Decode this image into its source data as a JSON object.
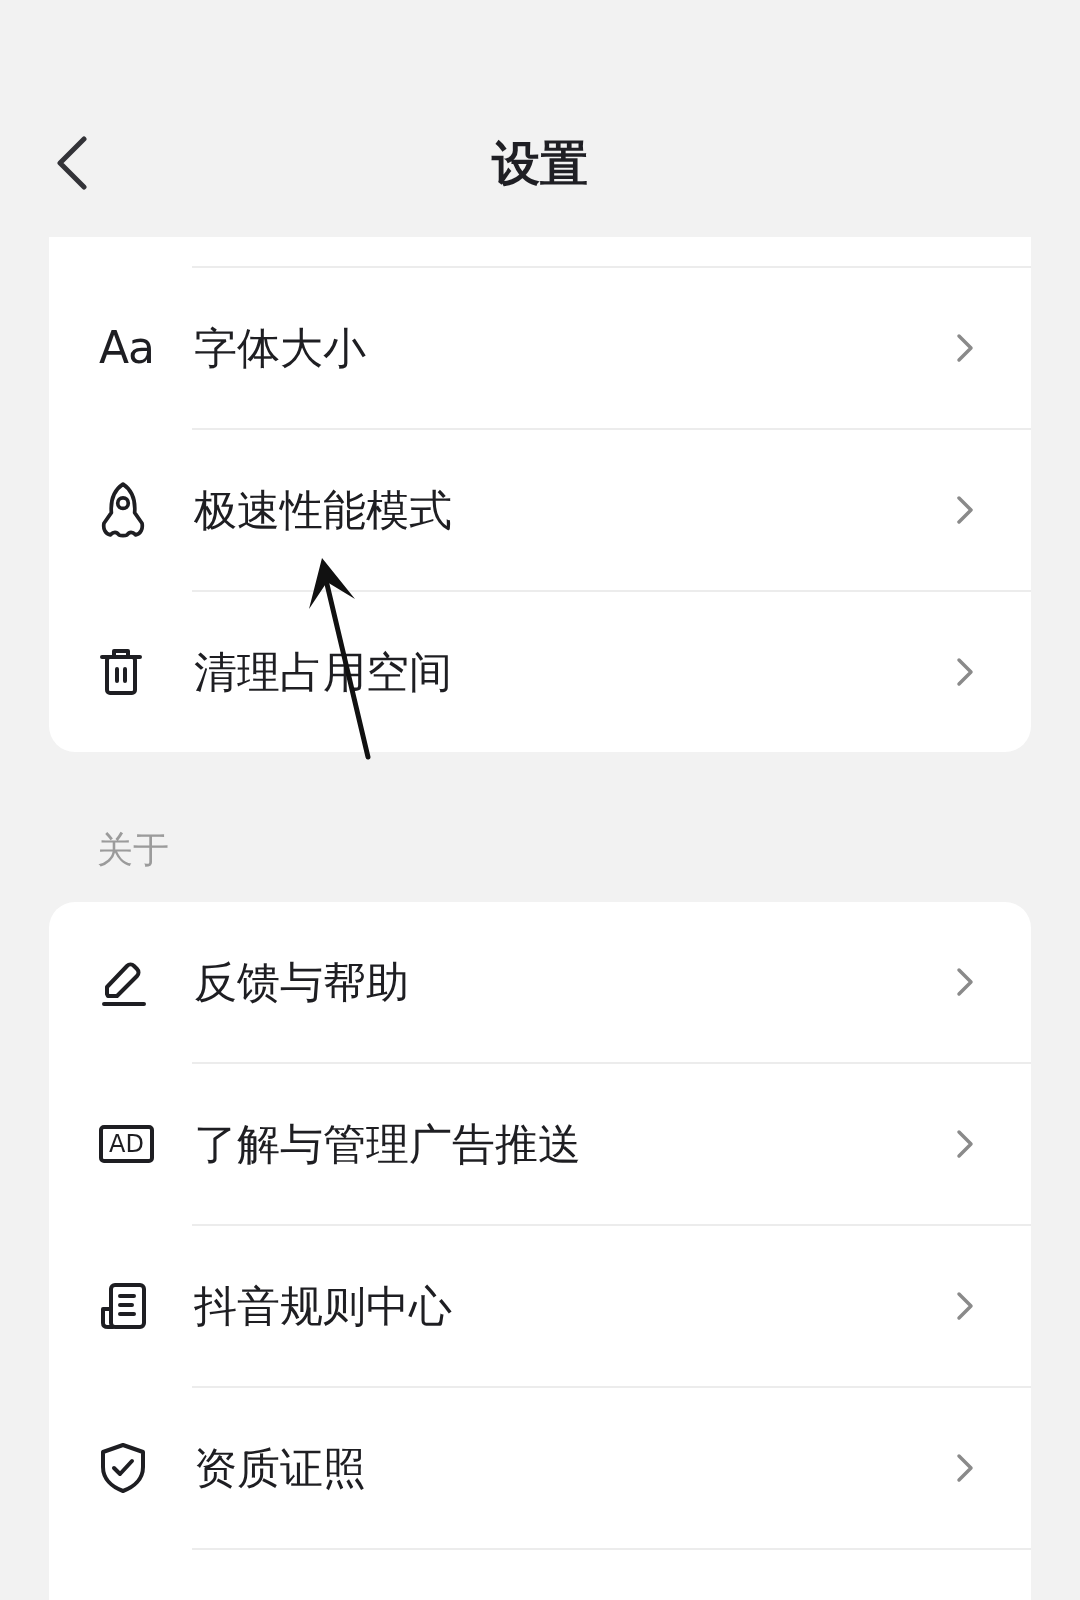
{
  "header": {
    "title": "设置"
  },
  "sections": [
    {
      "items": [
        {
          "kind": "letters",
          "icon_text": "Aa",
          "label": "字体大小"
        },
        {
          "kind": "rocket",
          "label": "极速性能模式"
        },
        {
          "kind": "trash",
          "label": "清理占用空间"
        }
      ]
    },
    {
      "title": "关于",
      "items": [
        {
          "kind": "pencil",
          "label": "反馈与帮助"
        },
        {
          "kind": "badge",
          "icon_text": "AD",
          "label": "了解与管理广告推送"
        },
        {
          "kind": "document",
          "label": "抖音规则中心"
        },
        {
          "kind": "shield",
          "label": "资质证照"
        }
      ]
    }
  ]
}
